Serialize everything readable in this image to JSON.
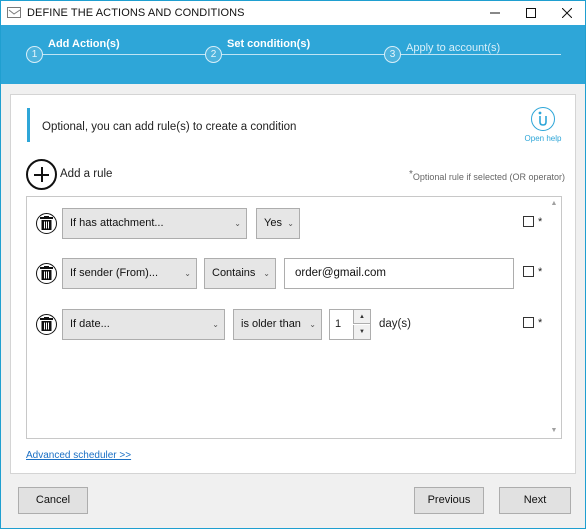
{
  "window": {
    "title": "DEFINE THE ACTIONS AND CONDITIONS",
    "minimize_symbol": "—",
    "maximize_symbol": "☐",
    "close_symbol": "✕"
  },
  "wizard": {
    "steps": [
      {
        "number": "1",
        "label": "Add Action(s)",
        "active": true
      },
      {
        "number": "2",
        "label": "Set condition(s)",
        "active": true
      },
      {
        "number": "3",
        "label": "Apply to account(s)",
        "active": false
      }
    ],
    "accent_color": "#2ea6d8"
  },
  "panel": {
    "intro_text": "Optional, you can add rule(s) to create a condition",
    "help_label": "Open help",
    "add_rule_label": "Add a rule",
    "or_note_asterisk": "*",
    "or_note": "Optional rule if selected (OR operator)",
    "advanced_link": "Advanced scheduler >>"
  },
  "rules": [
    {
      "condition": "If has attachment...",
      "operator": "Yes",
      "checkbox_mark": "*"
    },
    {
      "condition": "If sender (From)...",
      "operator": "Contains",
      "value": "order@gmail.com",
      "checkbox_mark": "*"
    },
    {
      "condition": "If date...",
      "operator": "is older than",
      "number": "1",
      "unit": "day(s)",
      "checkbox_mark": "*"
    }
  ],
  "footer": {
    "cancel_label": "Cancel",
    "previous_label": "Previous",
    "next_label": "Next"
  },
  "icons": {
    "app": "window-icon",
    "help": "help-icon",
    "add": "plus-circle-icon",
    "delete": "trash-icon",
    "dropdown": "chevron-down-icon"
  }
}
